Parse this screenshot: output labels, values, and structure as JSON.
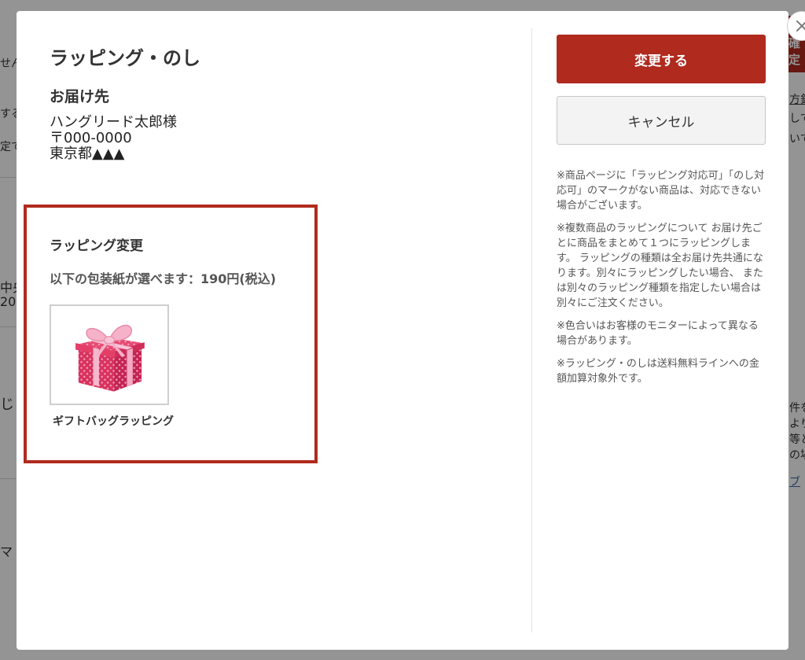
{
  "background": {
    "fragments": [
      "せん",
      "する",
      "定で",
      "中央",
      "20",
      "じ",
      "マ",
      "確定",
      "方針",
      "して",
      "いて",
      "件を",
      "より",
      "等と",
      "の場",
      "ブ"
    ]
  },
  "modal": {
    "title": "ラッピング・のし",
    "close_icon": "close-icon",
    "destination": {
      "heading": "お届け先",
      "name": "ハングリード太郎様",
      "postal": "〒000-0000",
      "address": "東京都▲▲▲"
    },
    "wrapping": {
      "heading": "ラッピング変更",
      "description": "以下の包装紙が選べます：190円(税込)",
      "options": [
        {
          "label": "ギフトバッグラッピング",
          "icon": "gift-box-icon"
        }
      ]
    },
    "actions": {
      "confirm_label": "変更する",
      "cancel_label": "キャンセル"
    },
    "notes": [
      "※商品ページに「ラッピング対応可」「のし対応可」のマークがない商品は、対応できない場合がございます。",
      "※複数商品のラッピングについて お届け先ごとに商品をまとめて１つにラッピングします。 ラッピングの種類は全お届け先共通になります。別々にラッピングしたい場合、 または別々のラッピング種類を指定したい場合は 別々にご注文ください。",
      "※色合いはお客様のモニターによって異なる場合があります。",
      "※ラッピング・のしは送料無料ラインへの金額加算対象外です。"
    ]
  },
  "colors": {
    "accent": "#b02a1e",
    "overlay": "rgba(0,0,0,0.42)"
  }
}
